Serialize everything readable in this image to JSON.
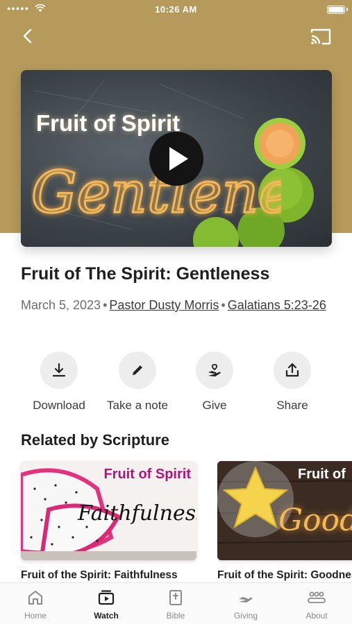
{
  "status_bar": {
    "signal": "●●●●●",
    "time": "10:26 AM"
  },
  "colors": {
    "header_background": "#b69a5c",
    "accent_text": "#1f1f1f",
    "hero_title_glow": "#f2b85a"
  },
  "hero": {
    "title": "Fruit of Spirit",
    "script_text": "Gentleness"
  },
  "sermon": {
    "title": "Fruit of The Spirit: Gentleness",
    "date": "March 5, 2023",
    "separator": "•",
    "speaker": "Pastor Dusty Morris",
    "scripture": "Galatians 5:23-26"
  },
  "actions": [
    {
      "label": "Download",
      "icon": "download-icon"
    },
    {
      "label": "Take a note",
      "icon": "pencil-icon"
    },
    {
      "label": "Give",
      "icon": "give-heart-hand-icon"
    },
    {
      "label": "Share",
      "icon": "share-icon"
    }
  ],
  "related": {
    "section_title": "Related by Scripture",
    "items": [
      {
        "thumb_title": "Fruit of Spirit",
        "thumb_script": "Faithfulness",
        "caption": "Fruit of the Spirit: Faithfulness"
      },
      {
        "thumb_title": "Fruit of",
        "thumb_script": "Good",
        "caption": "Fruit of the Spirit:  Goodness"
      }
    ]
  },
  "tabbar": {
    "tabs": [
      {
        "label": "Home",
        "icon": "home-icon",
        "active": false
      },
      {
        "label": "Watch",
        "icon": "watch-icon",
        "active": true
      },
      {
        "label": "Bible",
        "icon": "bible-icon",
        "active": false
      },
      {
        "label": "Giving",
        "icon": "giving-icon",
        "active": false
      },
      {
        "label": "About",
        "icon": "about-icon",
        "active": false
      }
    ]
  }
}
